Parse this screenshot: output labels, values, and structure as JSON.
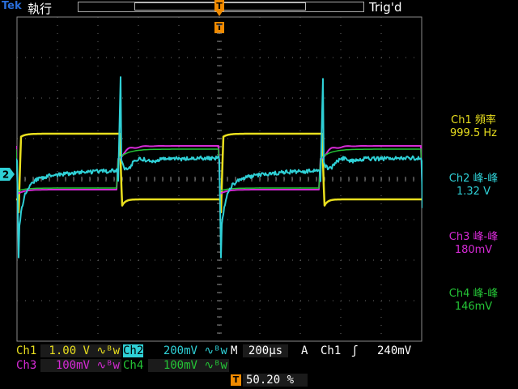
{
  "header": {
    "brand": "Tek",
    "mode": "執行",
    "trigger_state": "Trig'd",
    "trigger_marker": "T"
  },
  "colors": {
    "ch1": "#e9df1e",
    "ch2": "#2fd0d6",
    "ch3": "#d62ad6",
    "ch4": "#24c436",
    "trigger": "#f08a00"
  },
  "measurements": [
    {
      "label": "Ch1 頻率",
      "value": "999.5 Hz"
    },
    {
      "label": "Ch2 峰-峰",
      "value": "1.32 V"
    },
    {
      "label": "Ch3 峰-峰",
      "value": "180mV"
    },
    {
      "label": "Ch4 峰-峰",
      "value": "146mV"
    }
  ],
  "channel_marker": "2",
  "bottom": {
    "ch1_label": "Ch1",
    "ch1_scale": "1.00 V ∿ᴮw",
    "ch2_label": "Ch2",
    "ch2_scale": "200mV ∿ᴮw",
    "ch3_label": "Ch3",
    "ch3_scale": "100mV ∿ᴮw",
    "ch4_label": "Ch4",
    "ch4_scale": "100mV ∿ᴮw",
    "timebase_label": "M",
    "timebase": "200µs",
    "trigger_mode": "A",
    "trigger_source": "Ch1",
    "trigger_slope": "ʃ",
    "trigger_level": "240mV",
    "trigger_position_marker": "T",
    "trigger_position": "50.20 %"
  }
}
